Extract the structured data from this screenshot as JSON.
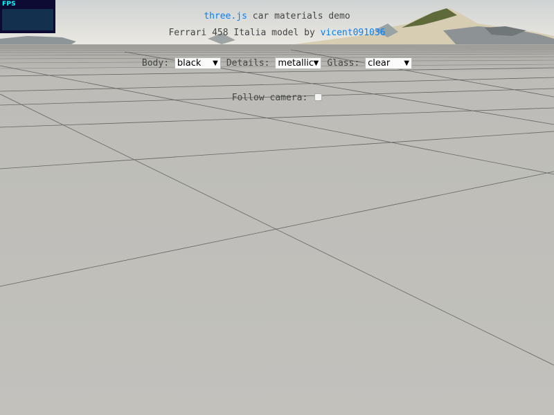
{
  "stats": {
    "label": "FPS"
  },
  "info": {
    "line1_link": "three.js",
    "line1_text": " car materials demo",
    "line2_text": "Ferrari 458 Italia model by ",
    "line2_link": "vicent091036"
  },
  "controls": {
    "body_label": "Body:",
    "body_value": "black",
    "details_label": "Details:",
    "details_value": "metallic",
    "glass_label": "Glass:",
    "glass_value": "clear",
    "follow_label": "Follow camera:",
    "follow_checked": false
  },
  "colors": {
    "ground": "#c1c0bb",
    "link": "#0080ff",
    "text": "#444444",
    "stats_bg": "#0d0b33",
    "stats_fg": "#00ffff"
  }
}
